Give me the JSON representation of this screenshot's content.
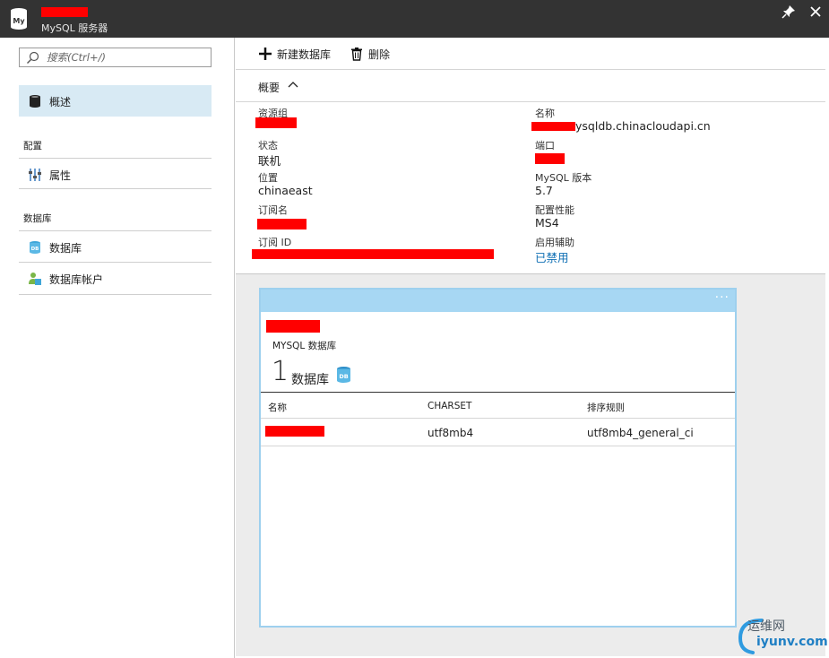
{
  "titlebar": {
    "subtitle": "MySQL 服务器",
    "logo_text": "My"
  },
  "search": {
    "placeholder": "搜索(Ctrl+/)"
  },
  "nav": {
    "overview": "概述",
    "section_settings": "配置",
    "properties": "属性",
    "section_databases": "数据库",
    "databases": "数据库",
    "db_accounts": "数据库帐户"
  },
  "toolbar": {
    "new_db": "新建数据库",
    "delete": "删除"
  },
  "essentials": {
    "label": "概要"
  },
  "props": {
    "resource_group_label": "资源组",
    "status_label": "状态",
    "status_value": "联机",
    "location_label": "位置",
    "location_value": "chinaeast",
    "subscription_name_label": "订阅名",
    "subscription_id_label": "订阅 ID",
    "name_label": "名称",
    "name_value": "ysqldb.chinacloudapi.cn",
    "port_label": "端口",
    "version_label": "MySQL 版本",
    "version_value": "5.7",
    "perf_label": "配置性能",
    "perf_value": "MS4",
    "assist_label": "启用辅助",
    "assist_value": "已禁用"
  },
  "tile": {
    "more": "···",
    "subtitle": "MYSQL 数据库",
    "count": "1",
    "count_label": "数据库",
    "db_icon_text": "DB",
    "columns": [
      "名称",
      "CHARSET",
      "排序规则"
    ],
    "rows": [
      {
        "charset": "utf8mb4",
        "collation": "utf8mb4_general_ci"
      }
    ]
  },
  "watermark": {
    "top": "运维网",
    "bottom": "iyunv.com"
  },
  "colors": {
    "titlebar": "#333333",
    "active_nav": "#d8eaf4",
    "tile_header": "#a7d7f3",
    "link": "#0f6fb4",
    "redaction": "#ff0000"
  }
}
